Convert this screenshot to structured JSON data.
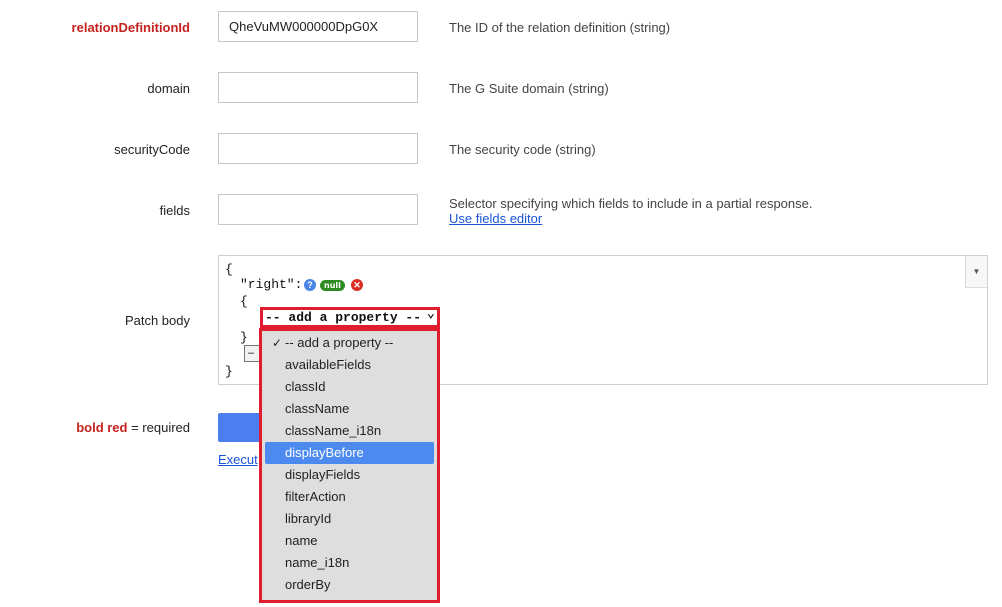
{
  "form": {
    "relation_definition_id": {
      "label": "relationDefinitionId",
      "value": "QheVuMW000000DpG0X",
      "description": "The ID of the relation definition (string)"
    },
    "domain": {
      "label": "domain",
      "value": "",
      "description": "The G Suite domain (string)"
    },
    "security_code": {
      "label": "securityCode",
      "value": "",
      "description": "The security code (string)"
    },
    "fields": {
      "label": "fields",
      "value": "",
      "description": "Selector specifying which fields to include in a partial response.",
      "link": "Use fields editor"
    },
    "patch_body": {
      "label": "Patch body",
      "open_brace": "{",
      "key": "\"right\":",
      "help_icon": "?",
      "null_badge": "null",
      "remove_icon": "✕",
      "inner_open": "{",
      "inner_close": "}",
      "close_brace": "}",
      "small_button": "–",
      "toggle_icon": "▼"
    },
    "legend": {
      "required_text": "bold red",
      "suffix": " = required"
    },
    "execute_link": "Execut"
  },
  "dropdown": {
    "selected_label": "-- add a property --",
    "options": [
      "-- add a property --",
      "availableFields",
      "classId",
      "className",
      "className_i18n",
      "displayBefore",
      "displayFields",
      "filterAction",
      "libraryId",
      "name",
      "name_i18n",
      "orderBy"
    ],
    "checked_index": 0,
    "highlighted_index": 5,
    "check_mark": "✓",
    "chevron": "⌄"
  },
  "colors": {
    "required_red": "#c5221f",
    "highlight_blue": "#4d8af0",
    "focus_border_red": "#e01d2e",
    "null_badge_green": "#2e8b22",
    "link_blue": "#1a55d8"
  }
}
